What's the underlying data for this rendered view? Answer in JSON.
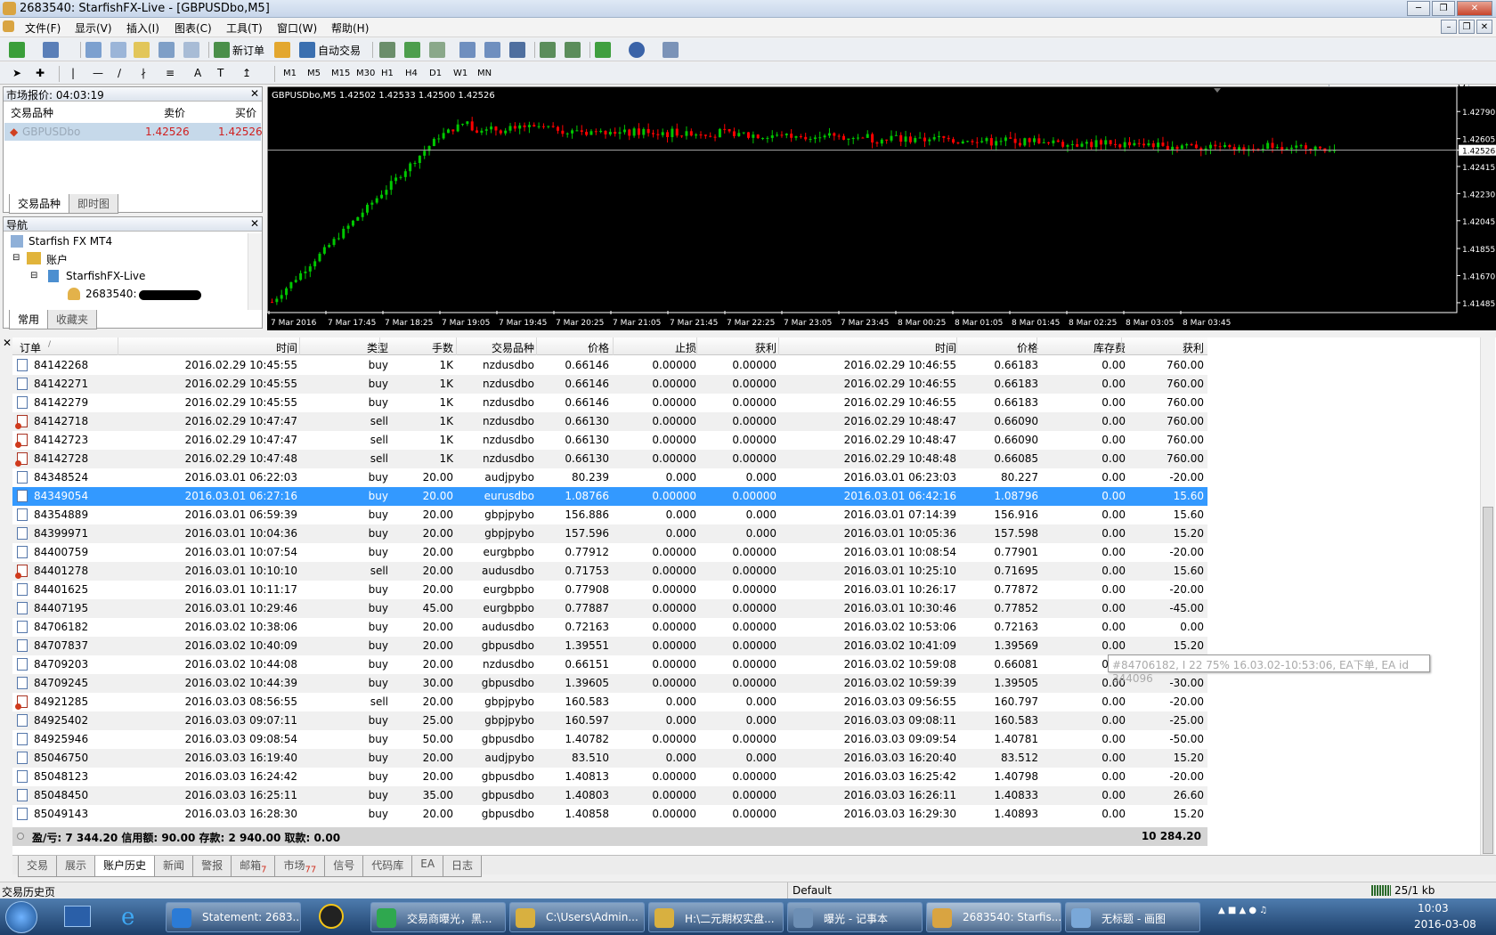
{
  "window": {
    "title": "2683540: StarfishFX-Live - [GBPUSDbo,M5]"
  },
  "menu": [
    "文件(F)",
    "显示(V)",
    "插入(I)",
    "图表(C)",
    "工具(T)",
    "窗口(W)",
    "帮助(H)"
  ],
  "toolbar": {
    "new_order": "新订单",
    "auto_trade": "自动交易",
    "timeframes": [
      "M1",
      "M5",
      "M15",
      "M30",
      "H1",
      "H4",
      "D1",
      "W1",
      "MN"
    ]
  },
  "market_watch": {
    "title": "市场报价: 04:03:19",
    "col_symbol": "交易品种",
    "col_bid": "卖价",
    "col_ask": "买价",
    "rows": [
      {
        "symbol": "GBPUSDbo",
        "bid": "1.42526",
        "ask": "1.42526"
      }
    ],
    "tabs": [
      "交易品种",
      "即时图"
    ]
  },
  "navigator": {
    "title": "导航",
    "items": [
      "Starfish FX MT4",
      "账户",
      "StarfishFX-Live",
      "2683540:"
    ],
    "tabs": [
      "常用",
      "收藏夹"
    ]
  },
  "chart": {
    "header": "GBPUSDbo,M5  1.42502 1.42533 1.42500 1.42526",
    "price_labels": [
      "1.42790",
      "1.42605",
      "1.42526",
      "1.42415",
      "1.42230",
      "1.42045",
      "1.41855",
      "1.41670",
      "1.41485"
    ],
    "time_labels": [
      "7 Mar 2016",
      "7 Mar 17:45",
      "7 Mar 18:25",
      "7 Mar 19:05",
      "7 Mar 19:45",
      "7 Mar 20:25",
      "7 Mar 21:05",
      "7 Mar 21:45",
      "7 Mar 22:25",
      "7 Mar 23:05",
      "7 Mar 23:45",
      "8 Mar 00:25",
      "8 Mar 01:05",
      "8 Mar 01:45",
      "8 Mar 02:25",
      "8 Mar 03:05",
      "8 Mar 03:45"
    ],
    "current_price": "1.42526"
  },
  "history": {
    "headers": [
      "订单",
      "/",
      "时间",
      "类型",
      "手数",
      "交易品种",
      "价格",
      "止损",
      "获利",
      "时间",
      "价格",
      "库存费",
      "获利"
    ],
    "rows": [
      [
        "84142268",
        "2016.02.29 10:45:55",
        "buy",
        "1K",
        "nzdusdbo",
        "0.66146",
        "0.00000",
        "0.00000",
        "2016.02.29 10:46:55",
        "0.66183",
        "0.00",
        "760.00"
      ],
      [
        "84142271",
        "2016.02.29 10:45:55",
        "buy",
        "1K",
        "nzdusdbo",
        "0.66146",
        "0.00000",
        "0.00000",
        "2016.02.29 10:46:55",
        "0.66183",
        "0.00",
        "760.00"
      ],
      [
        "84142279",
        "2016.02.29 10:45:55",
        "buy",
        "1K",
        "nzdusdbo",
        "0.66146",
        "0.00000",
        "0.00000",
        "2016.02.29 10:46:55",
        "0.66183",
        "0.00",
        "760.00"
      ],
      [
        "84142718",
        "2016.02.29 10:47:47",
        "sell",
        "1K",
        "nzdusdbo",
        "0.66130",
        "0.00000",
        "0.00000",
        "2016.02.29 10:48:47",
        "0.66090",
        "0.00",
        "760.00"
      ],
      [
        "84142723",
        "2016.02.29 10:47:47",
        "sell",
        "1K",
        "nzdusdbo",
        "0.66130",
        "0.00000",
        "0.00000",
        "2016.02.29 10:48:47",
        "0.66090",
        "0.00",
        "760.00"
      ],
      [
        "84142728",
        "2016.02.29 10:47:48",
        "sell",
        "1K",
        "nzdusdbo",
        "0.66130",
        "0.00000",
        "0.00000",
        "2016.02.29 10:48:48",
        "0.66085",
        "0.00",
        "760.00"
      ],
      [
        "84348524",
        "2016.03.01 06:22:03",
        "buy",
        "20.00",
        "audjpybo",
        "80.239",
        "0.000",
        "0.000",
        "2016.03.01 06:23:03",
        "80.227",
        "0.00",
        "-20.00"
      ],
      [
        "84349054",
        "2016.03.01 06:27:16",
        "buy",
        "20.00",
        "eurusdbo",
        "1.08766",
        "0.00000",
        "0.00000",
        "2016.03.01 06:42:16",
        "1.08796",
        "0.00",
        "15.60"
      ],
      [
        "84354889",
        "2016.03.01 06:59:39",
        "buy",
        "20.00",
        "gbpjpybo",
        "156.886",
        "0.000",
        "0.000",
        "2016.03.01 07:14:39",
        "156.916",
        "0.00",
        "15.60"
      ],
      [
        "84399971",
        "2016.03.01 10:04:36",
        "buy",
        "20.00",
        "gbpjpybo",
        "157.596",
        "0.000",
        "0.000",
        "2016.03.01 10:05:36",
        "157.598",
        "0.00",
        "15.20"
      ],
      [
        "84400759",
        "2016.03.01 10:07:54",
        "buy",
        "20.00",
        "eurgbpbo",
        "0.77912",
        "0.00000",
        "0.00000",
        "2016.03.01 10:08:54",
        "0.77901",
        "0.00",
        "-20.00"
      ],
      [
        "84401278",
        "2016.03.01 10:10:10",
        "sell",
        "20.00",
        "audusdbo",
        "0.71753",
        "0.00000",
        "0.00000",
        "2016.03.01 10:25:10",
        "0.71695",
        "0.00",
        "15.60"
      ],
      [
        "84401625",
        "2016.03.01 10:11:17",
        "buy",
        "20.00",
        "eurgbpbo",
        "0.77908",
        "0.00000",
        "0.00000",
        "2016.03.01 10:26:17",
        "0.77872",
        "0.00",
        "-20.00"
      ],
      [
        "84407195",
        "2016.03.01 10:29:46",
        "buy",
        "45.00",
        "eurgbpbo",
        "0.77887",
        "0.00000",
        "0.00000",
        "2016.03.01 10:30:46",
        "0.77852",
        "0.00",
        "-45.00"
      ],
      [
        "84706182",
        "2016.03.02 10:38:06",
        "buy",
        "20.00",
        "audusdbo",
        "0.72163",
        "0.00000",
        "0.00000",
        "2016.03.02 10:53:06",
        "0.72163",
        "0.00",
        "0.00"
      ],
      [
        "84707837",
        "2016.03.02 10:40:09",
        "buy",
        "20.00",
        "gbpusdbo",
        "1.39551",
        "0.00000",
        "0.00000",
        "2016.03.02 10:41:09",
        "1.39569",
        "0.00",
        "15.20"
      ],
      [
        "84709203",
        "2016.03.02 10:44:08",
        "buy",
        "20.00",
        "nzdusdbo",
        "0.66151",
        "0.00000",
        "0.00000",
        "2016.03.02 10:59:08",
        "0.66081",
        "0.00",
        "-20.00"
      ],
      [
        "84709245",
        "2016.03.02 10:44:39",
        "buy",
        "30.00",
        "gbpusdbo",
        "1.39605",
        "0.00000",
        "0.00000",
        "2016.03.02 10:59:39",
        "1.39505",
        "0.00",
        "-30.00"
      ],
      [
        "84921285",
        "2016.03.03 08:56:55",
        "sell",
        "20.00",
        "gbpjpybo",
        "160.583",
        "0.000",
        "0.000",
        "2016.03.03 09:56:55",
        "160.797",
        "0.00",
        "-20.00"
      ],
      [
        "84925402",
        "2016.03.03 09:07:11",
        "buy",
        "25.00",
        "gbpjpybo",
        "160.597",
        "0.000",
        "0.000",
        "2016.03.03 09:08:11",
        "160.583",
        "0.00",
        "-25.00"
      ],
      [
        "84925946",
        "2016.03.03 09:08:54",
        "buy",
        "50.00",
        "gbpusdbo",
        "1.40782",
        "0.00000",
        "0.00000",
        "2016.03.03 09:09:54",
        "1.40781",
        "0.00",
        "-50.00"
      ],
      [
        "85046750",
        "2016.03.03 16:19:40",
        "buy",
        "20.00",
        "audjpybo",
        "83.510",
        "0.000",
        "0.000",
        "2016.03.03 16:20:40",
        "83.512",
        "0.00",
        "15.20"
      ],
      [
        "85048123",
        "2016.03.03 16:24:42",
        "buy",
        "20.00",
        "gbpusdbo",
        "1.40813",
        "0.00000",
        "0.00000",
        "2016.03.03 16:25:42",
        "1.40798",
        "0.00",
        "-20.00"
      ],
      [
        "85048450",
        "2016.03.03 16:25:11",
        "buy",
        "35.00",
        "gbpusdbo",
        "1.40803",
        "0.00000",
        "0.00000",
        "2016.03.03 16:26:11",
        "1.40833",
        "0.00",
        "26.60"
      ],
      [
        "85049143",
        "2016.03.03 16:28:30",
        "buy",
        "20.00",
        "gbpusdbo",
        "1.40858",
        "0.00000",
        "0.00000",
        "2016.03.03 16:29:30",
        "1.40893",
        "0.00",
        "15.20"
      ]
    ],
    "selected_index": 7,
    "summary_left": "盈/亏: 7 344.20  信用额: 90.00  存款: 2 940.00  取款: 0.00",
    "summary_total": "10 284.20",
    "tooltip": "#84706182, I 22 75% 16.03.02-10:53:06, EA下单, EA id 344096"
  },
  "terminal_tabs": [
    "交易",
    "展示",
    "账户历史",
    "新闻",
    "警报",
    "邮箱",
    "市场",
    "信号",
    "代码库",
    "EA",
    "日志"
  ],
  "terminal_tab_badges": {
    "mail": "7",
    "market": "77"
  },
  "status": {
    "left": "交易历史页",
    "profile": "Default",
    "traffic": "25/1 kb"
  },
  "taskbar": {
    "items": [
      "Statement: 2683...",
      "交易商曝光，黑...",
      "C:\\Users\\Admin...",
      "H:\\二元期权实盘...",
      "曝光 - 记事本",
      "2683540: Starfis...",
      "无标题 - 画图"
    ],
    "time": "10:03",
    "date": "2016-03-08"
  },
  "colors": {
    "bull": "#00c800",
    "bear": "#ff0000",
    "selection": "#3399ff"
  }
}
